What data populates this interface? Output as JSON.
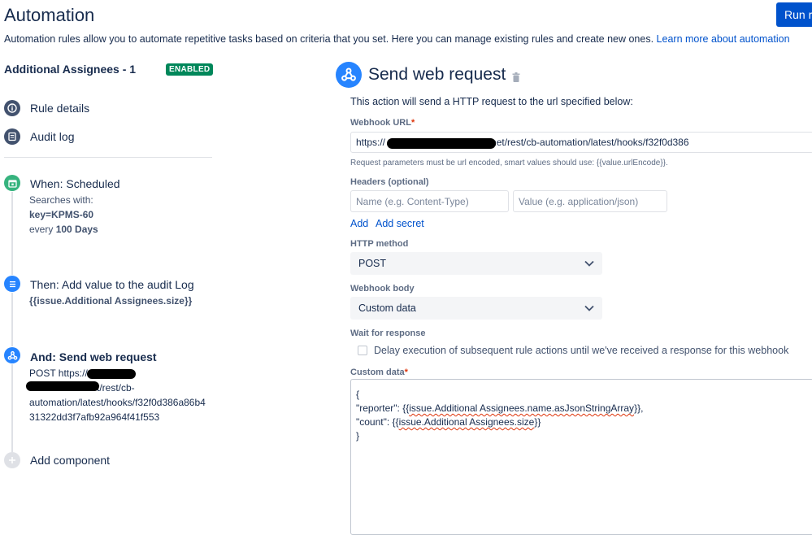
{
  "header": {
    "title": "Automation",
    "run_button": "Run ru",
    "description": "Automation rules allow you to automate repetitive tasks based on criteria that you set. Here you can manage existing rules and create new ones.",
    "learn_more": "Learn more about automation"
  },
  "rule": {
    "name": "Additional Assignees - 1",
    "status": "ENABLED"
  },
  "sidebar": {
    "rule_details": "Rule details",
    "audit_log": "Audit log"
  },
  "steps": {
    "when": {
      "title": "When: Scheduled",
      "searches_with": "Searches with:",
      "jql": "key=KPMS-60",
      "every": "every",
      "interval": "100 Days"
    },
    "then": {
      "title": "Then: Add value to the audit Log",
      "value": "{{issue.Additional Assignees.size}}"
    },
    "and": {
      "title": "And: Send web request",
      "method_prefix": "POST https://",
      "url_part1": "t/rest/cb-",
      "url_part2": "automation/latest/hooks/f32f0d386a86b4",
      "url_part3": "31322dd3f7afb92a964f41f553"
    },
    "add_component": "Add component"
  },
  "panel": {
    "title": "Send web request",
    "intro": "This action will send a HTTP request to the url specified below:",
    "webhook_url_label": "Webhook URL",
    "webhook_url_prefix": "https://",
    "webhook_url_suffix": "net/rest/cb-automation/latest/hooks/f32f0d386",
    "url_hint": "Request parameters must be url encoded, smart values should use: {{value.urlEncode}}.",
    "headers_label": "Headers (optional)",
    "header_name_placeholder": "Name (e.g. Content-Type)",
    "header_value_placeholder": "Value (e.g. application/json)",
    "add": "Add",
    "add_secret": "Add secret",
    "http_method_label": "HTTP method",
    "http_method_value": "POST",
    "webhook_body_label": "Webhook body",
    "webhook_body_value": "Custom data",
    "wait_label": "Wait for response",
    "wait_checkbox": "Delay execution of subsequent rule actions until we've received a response for this webhook",
    "custom_data_label": "Custom data",
    "custom_data": {
      "line1": "{",
      "line2_key": "\"reporter\": {{",
      "line2_val": "issue.Additional Assignees.name.asJsonStringArray",
      "line2_end": "}},",
      "line3_key": "\"count\": {{",
      "line3_val": "issue.Additional Assignees.size",
      "line3_end": "}}",
      "line4": "}"
    }
  },
  "colors": {
    "primary": "#0052cc",
    "enabled": "#00875a",
    "trigger": "#36b37e",
    "action": "#2684ff"
  }
}
